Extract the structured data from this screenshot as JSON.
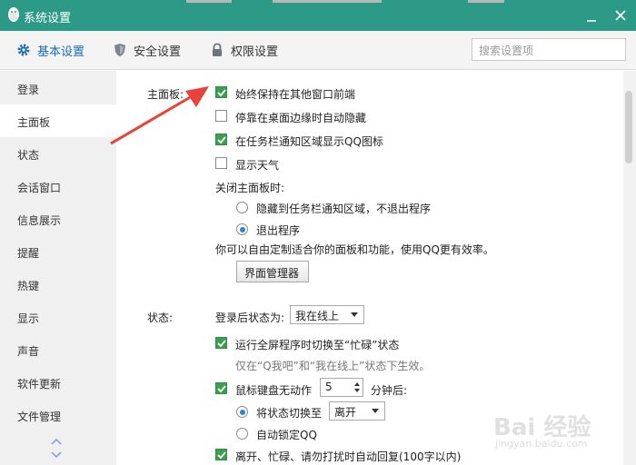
{
  "window": {
    "title": "系统设置"
  },
  "toolbar": {
    "tabs": [
      {
        "label": "基本设置",
        "icon": "gear-icon",
        "active": true
      },
      {
        "label": "安全设置",
        "icon": "shield-icon",
        "active": false
      },
      {
        "label": "权限设置",
        "icon": "lock-icon",
        "active": false
      }
    ],
    "search_placeholder": "搜索设置项"
  },
  "sidebar": {
    "items": [
      {
        "label": "登录"
      },
      {
        "label": "主面板",
        "active": true
      },
      {
        "label": "状态"
      },
      {
        "label": "会话窗口"
      },
      {
        "label": "信息展示"
      },
      {
        "label": "提醒"
      },
      {
        "label": "热键"
      },
      {
        "label": "显示"
      },
      {
        "label": "声音"
      },
      {
        "label": "软件更新"
      },
      {
        "label": "文件管理"
      }
    ]
  },
  "main_panel": {
    "section_label": "主面板:",
    "options": [
      {
        "label": "始终保持在其他窗口前端",
        "checked": true
      },
      {
        "label": "停靠在桌面边缘时自动隐藏",
        "checked": false
      },
      {
        "label": "在任务栏通知区域显示QQ图标",
        "checked": true
      },
      {
        "label": "显示天气",
        "checked": false
      }
    ],
    "close_label": "关闭主面板时:",
    "close_options": [
      {
        "label": "隐藏到任务栏通知区域，不退出程序",
        "selected": false
      },
      {
        "label": "退出程序",
        "selected": true
      }
    ],
    "customize_text": "你可以自由定制适合你的面板和功能，使用QQ更有效率。",
    "manager_button": "界面管理器"
  },
  "status": {
    "section_label": "状态:",
    "login_status_label": "登录后状态为:",
    "login_status_value": "我在线上",
    "fullscreen_option": {
      "label": "运行全屏程序时切换至“忙碌”状态",
      "checked": true
    },
    "fullscreen_note": "仅在“Q我吧”和“我在线上”状态下生效。",
    "idle_option": {
      "label": "鼠标键盘无动作",
      "checked": true
    },
    "idle_minutes": "5",
    "idle_suffix": "分钟后:",
    "idle_choices": [
      {
        "label": "将状态切换至",
        "selected": true,
        "value": "离开"
      },
      {
        "label": "自动锁定QQ",
        "selected": false
      }
    ],
    "auto_reply": {
      "label": "离开、忙碌、请勿打扰时自动回复(100字以内)",
      "checked": true
    }
  },
  "watermark": {
    "text": "Bai 经验",
    "sub": "jingyan.baidu.com"
  },
  "colors": {
    "titlebar": "#2c9a86",
    "accent": "#1b6db5",
    "check": "#3aa04f",
    "arrow": "#e8423c"
  }
}
